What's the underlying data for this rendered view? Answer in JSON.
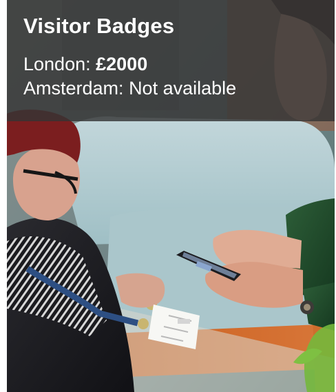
{
  "badge_card": {
    "title": "Visitor Badges",
    "london_label": "London:",
    "london_price": "£2000",
    "amsterdam_label": "Amsterdam:",
    "amsterdam_value": "Not available"
  },
  "photo": {
    "icon": "event-badge-scan-photo",
    "accent_color": "#c76a2c",
    "sofa_color": "#b8cdd2",
    "jacket_color": "#1f4a2b"
  }
}
